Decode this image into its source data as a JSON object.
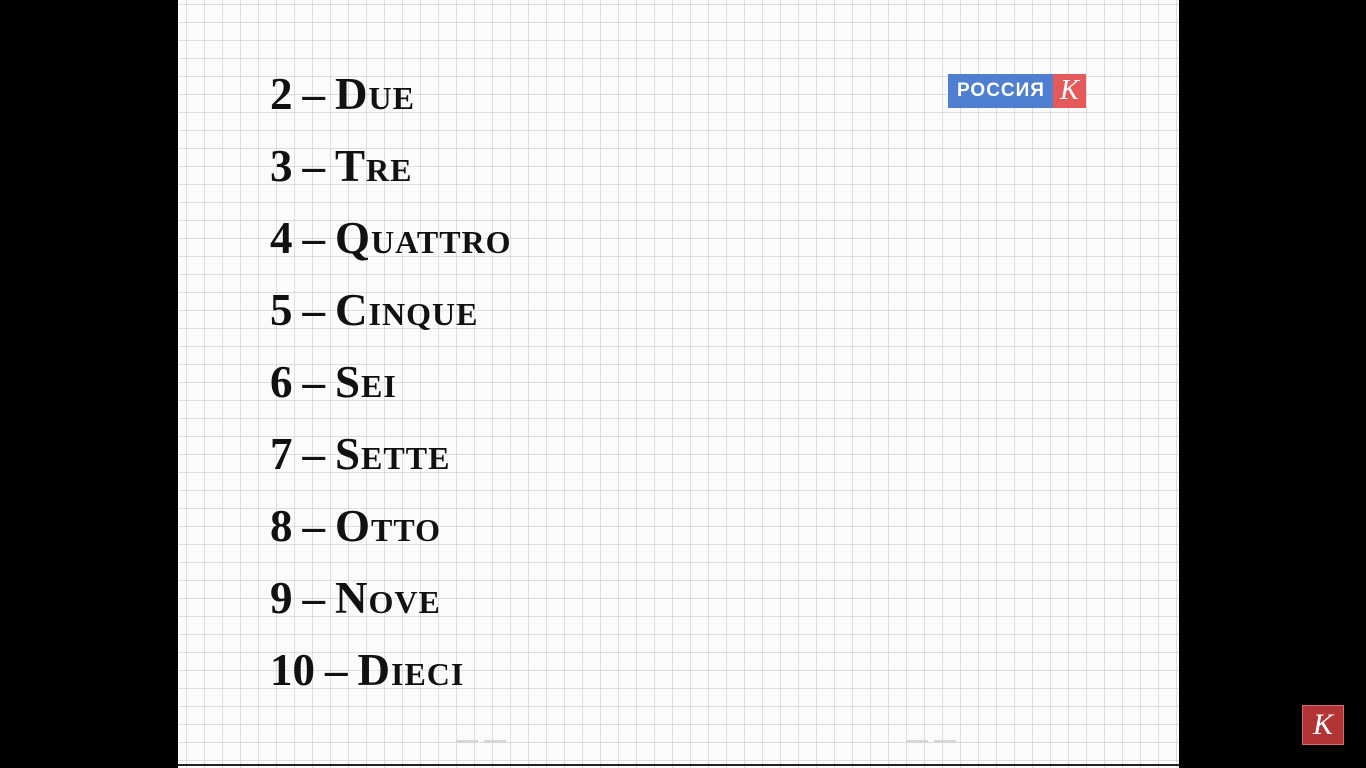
{
  "channel_logo": {
    "text": "РОССИЯ",
    "letter": "К",
    "colors": {
      "blue": "#4f7fd0",
      "red": "#e45a5a"
    }
  },
  "corner_logo": {
    "letter": "К",
    "color": "#b23434"
  },
  "numbers": [
    {
      "num": "2",
      "sep": "–",
      "word": "Due"
    },
    {
      "num": "3",
      "sep": "–",
      "word": "Tre"
    },
    {
      "num": "4",
      "sep": "–",
      "word": "Quattro"
    },
    {
      "num": "5",
      "sep": "–",
      "word": "Cinque"
    },
    {
      "num": "6",
      "sep": "–",
      "word": "Sei"
    },
    {
      "num": "7",
      "sep": "–",
      "word": "Sette"
    },
    {
      "num": "8",
      "sep": "–",
      "word": "Otto"
    },
    {
      "num": "9",
      "sep": "–",
      "word": "Nove"
    },
    {
      "num": "10",
      "sep": "–",
      "word": "Dieci"
    }
  ]
}
